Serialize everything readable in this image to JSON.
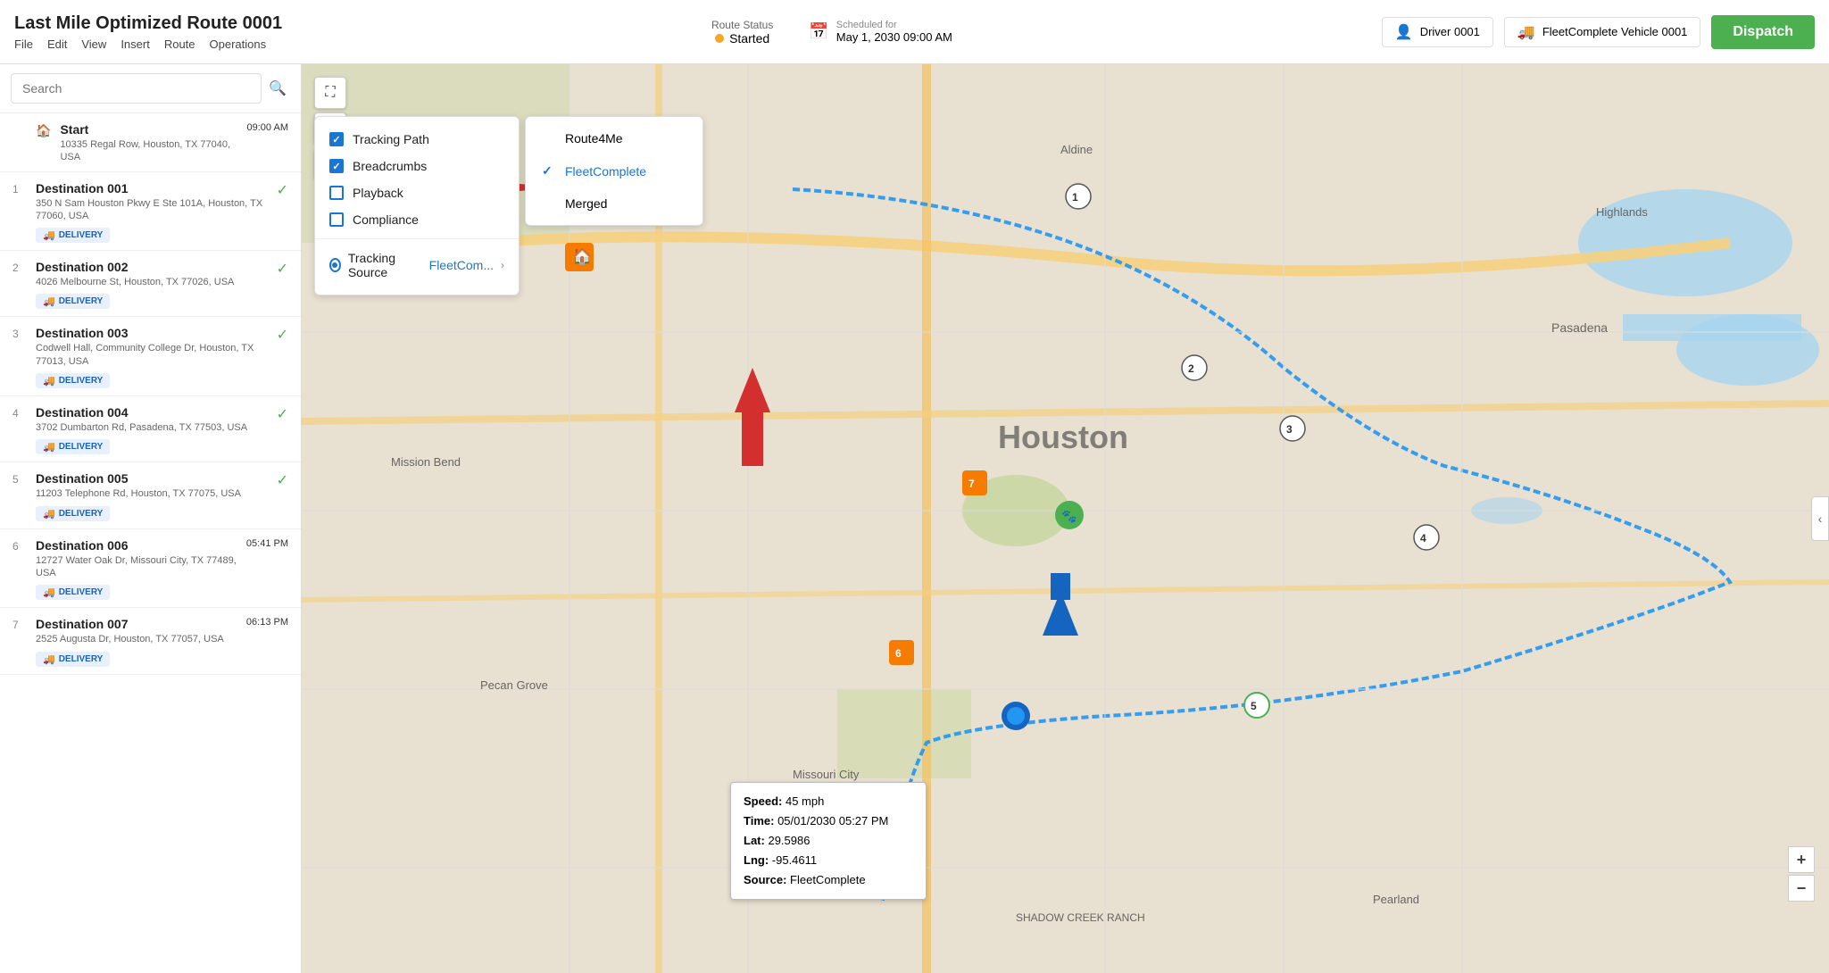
{
  "header": {
    "title": "Last Mile Optimized Route 0001",
    "menu": [
      "File",
      "Edit",
      "View",
      "Insert",
      "Route",
      "Operations"
    ],
    "route_status_label": "Route Status",
    "route_status_value": "Started",
    "scheduled_label": "Scheduled for",
    "scheduled_value": "May 1, 2030 09:00 AM",
    "driver_label": "Driver 0001",
    "vehicle_label": "FleetComplete Vehicle 0001",
    "dispatch_label": "Dispatch"
  },
  "sidebar": {
    "search_placeholder": "Search",
    "items": [
      {
        "num": "",
        "name": "Start",
        "addr": "10335 Regal Row, Houston, TX 77040, USA",
        "time": "09:00 AM",
        "type": "start",
        "badge": null
      },
      {
        "num": "1",
        "name": "Destination 001",
        "addr": "350 N Sam Houston Pkwy E Ste 101A, Houston, TX 77060, USA",
        "time": "",
        "type": "delivery",
        "badge": "DELIVERY",
        "checked": true
      },
      {
        "num": "2",
        "name": "Destination 002",
        "addr": "4026 Melbourne St, Houston, TX 77026, USA",
        "time": "",
        "type": "delivery",
        "badge": "DELIVERY",
        "checked": true
      },
      {
        "num": "3",
        "name": "Destination 003",
        "addr": "Codwell Hall, Community College Dr, Houston, TX 77013, USA",
        "time": "",
        "type": "delivery",
        "badge": "DELIVERY",
        "checked": true
      },
      {
        "num": "4",
        "name": "Destination 004",
        "addr": "3702 Dumbarton Rd, Pasadena, TX 77503, USA",
        "time": "",
        "type": "delivery",
        "badge": "DELIVERY",
        "checked": true
      },
      {
        "num": "5",
        "name": "Destination 005",
        "addr": "11203 Telephone Rd, Houston, TX 77075, USA",
        "time": "",
        "type": "delivery",
        "badge": "DELIVERY",
        "checked": true
      },
      {
        "num": "6",
        "name": "Destination 006",
        "addr": "12727 Water Oak Dr, Missouri City, TX 77489, USA",
        "time": "05:41 PM",
        "type": "delivery",
        "badge": "DELIVERY",
        "checked": false
      },
      {
        "num": "7",
        "name": "Destination 007",
        "addr": "2525 Augusta Dr, Houston, TX 77057, USA",
        "time": "06:13 PM",
        "type": "delivery",
        "badge": "DELIVERY",
        "checked": false
      }
    ]
  },
  "tracking_menu": {
    "tracking_path_label": "Tracking Path",
    "breadcrumbs_label": "Breadcrumbs",
    "playback_label": "Playback",
    "compliance_label": "Compliance",
    "tracking_source_label": "Tracking Source",
    "tracking_source_value": "FleetCom...",
    "tracking_path_checked": true,
    "breadcrumbs_checked": true,
    "playback_checked": false,
    "compliance_checked": false
  },
  "source_submenu": {
    "items": [
      {
        "label": "Route4Me",
        "active": false
      },
      {
        "label": "FleetComplete",
        "active": true
      },
      {
        "label": "Merged",
        "active": false
      }
    ]
  },
  "info_popup": {
    "speed_label": "Speed:",
    "speed_value": "45 mph",
    "time_label": "Time:",
    "time_value": "05/01/2030 05:27 PM",
    "lat_label": "Lat:",
    "lat_value": "29.5986",
    "lng_label": "Lng:",
    "lng_value": "-95.4611",
    "source_label": "Source:",
    "source_value": "FleetComplete"
  },
  "zoom": {
    "plus": "+",
    "minus": "−"
  },
  "map_label": "SHADOW CREEK RANCH"
}
